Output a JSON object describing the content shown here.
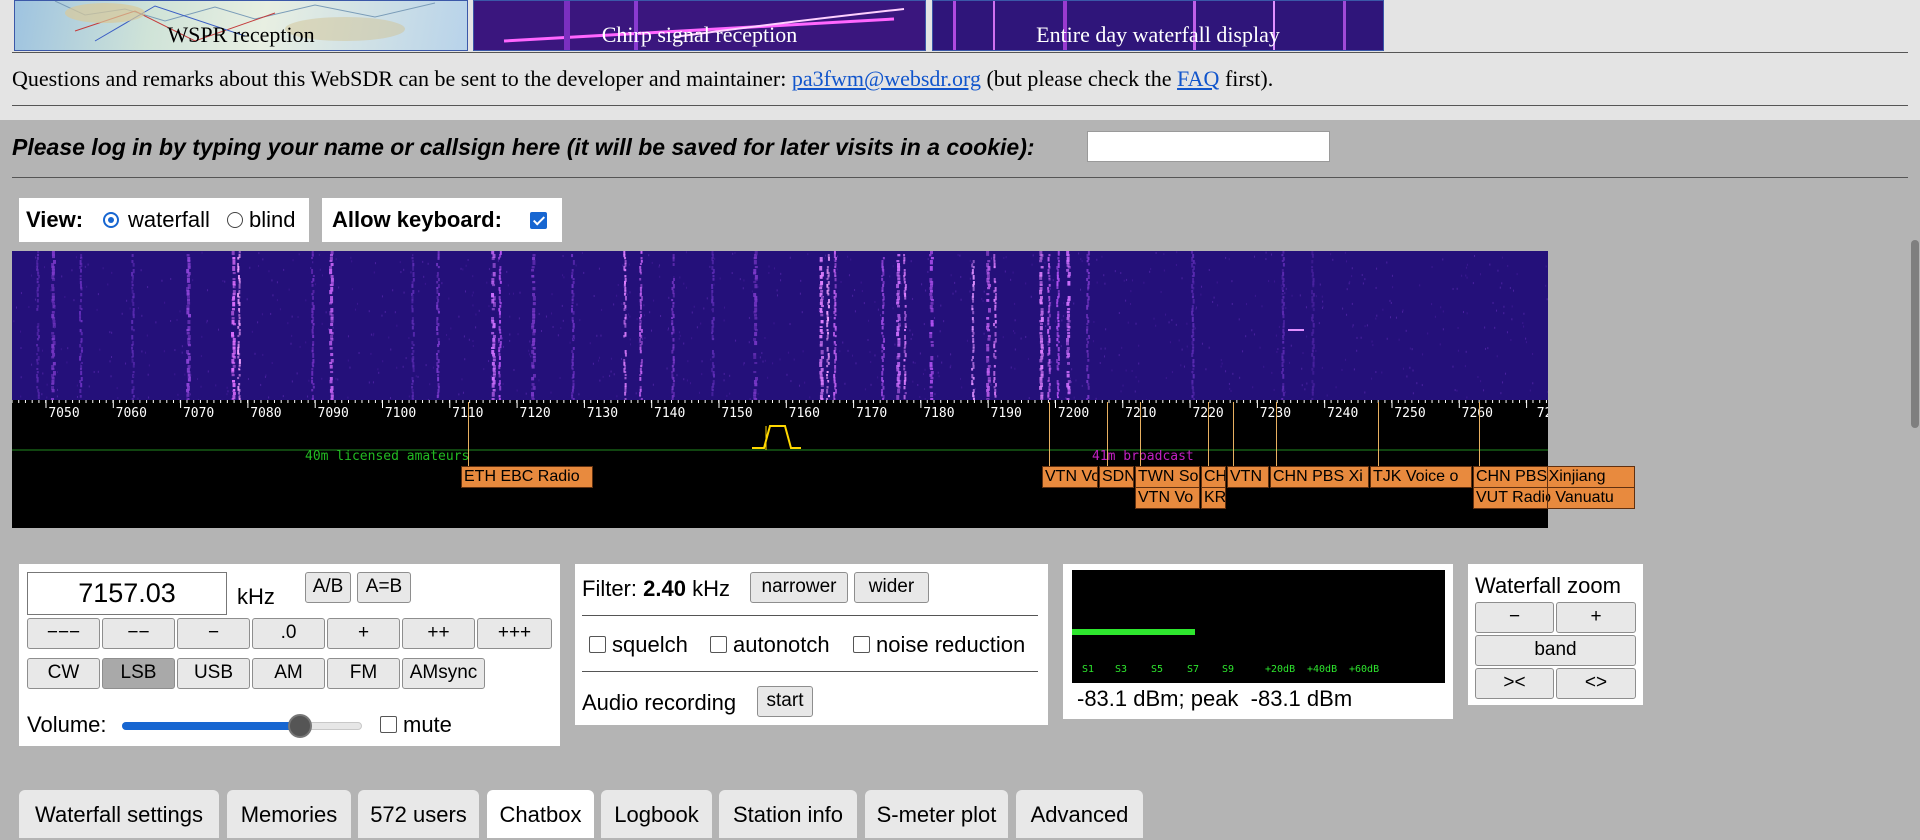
{
  "thumbnails": [
    {
      "label": "WSPR reception"
    },
    {
      "label": "Chirp signal reception"
    },
    {
      "label": "Entire day waterfall display"
    }
  ],
  "contact": {
    "text_before": "Questions and remarks about this WebSDR can be sent to the developer and maintainer: ",
    "email": "pa3fwm@websdr.org",
    "text_middle": " (but please check the ",
    "faq_link": "FAQ",
    "text_after": " first)."
  },
  "login": {
    "label": "Please log in by typing your name or callsign here (it will be saved for later visits in a cookie):",
    "value": ""
  },
  "view": {
    "label": "View:",
    "options": [
      "waterfall",
      "blind"
    ],
    "selected": "waterfall",
    "keyboard_label": "Allow keyboard:",
    "keyboard_checked": true
  },
  "scale": {
    "ticks": [
      "7050",
      "7060",
      "7070",
      "7080",
      "7090",
      "7100",
      "7110",
      "7120",
      "7130",
      "7140",
      "7150",
      "7160",
      "7170",
      "7180",
      "7190",
      "7200",
      "7210",
      "7220",
      "7230",
      "7240",
      "7250",
      "7260",
      "72"
    ],
    "band_amateur": "40m licensed amateurs",
    "band_broadcast": "41m broadcast"
  },
  "stations": [
    {
      "label": "ETH EBC Radio"
    },
    {
      "label": "VTN Vo"
    },
    {
      "label": "SDN"
    },
    {
      "label": "TWN So"
    },
    {
      "label": "VTN Vo"
    },
    {
      "label": "CHN"
    },
    {
      "label": "KRE"
    },
    {
      "label": "VTN"
    },
    {
      "label": "CHN PBS Xi"
    },
    {
      "label": "TJK Voice o"
    },
    {
      "label": "CHN PBS Xinjiang"
    },
    {
      "label": "VUT Radio Vanuatu"
    }
  ],
  "tuner": {
    "frequency": "7157.03",
    "unit": "kHz",
    "ab_button": "A/B",
    "aeqb_button": "A=B",
    "step_buttons": [
      "−−−",
      "−−",
      "−",
      ".0",
      "+",
      "++",
      "+++"
    ],
    "modes": [
      "CW",
      "LSB",
      "USB",
      "AM",
      "FM",
      "AMsync"
    ],
    "active_mode": "LSB",
    "volume_label": "Volume:",
    "volume_level": 0.74,
    "mute_label": "mute",
    "mute_checked": false
  },
  "filter": {
    "label": "Filter:",
    "width": "2.40",
    "unit": "kHz",
    "narrower": "narrower",
    "wider": "wider",
    "squelch": "squelch",
    "autonotch": "autonotch",
    "noise_reduction": "noise reduction",
    "audio_recording": "Audio recording",
    "start": "start"
  },
  "smeter": {
    "scale_labels": [
      "S1",
      "S3",
      "S5",
      "S7",
      "S9",
      "+20dB",
      "+40dB",
      "+60dB"
    ],
    "level_fraction": 0.33,
    "reading": "-83.1 dBm; peak  -83.1 dBm",
    "bar_color": "#2ee62e"
  },
  "zoom": {
    "title": "Waterfall zoom",
    "minus": "−",
    "plus": "+",
    "band": "band",
    "narrow": "><",
    "wide": "<>"
  },
  "tabs": [
    {
      "label": "Waterfall settings"
    },
    {
      "label": "Memories"
    },
    {
      "label": "572 users"
    },
    {
      "label": "Chatbox"
    },
    {
      "label": "Logbook"
    },
    {
      "label": "Station info"
    },
    {
      "label": "S-meter plot"
    },
    {
      "label": "Advanced"
    }
  ],
  "active_tab": "Chatbox",
  "colors": {
    "station_tag": "#e88a3e",
    "link": "#1155cc",
    "accent": "#1766d1"
  }
}
